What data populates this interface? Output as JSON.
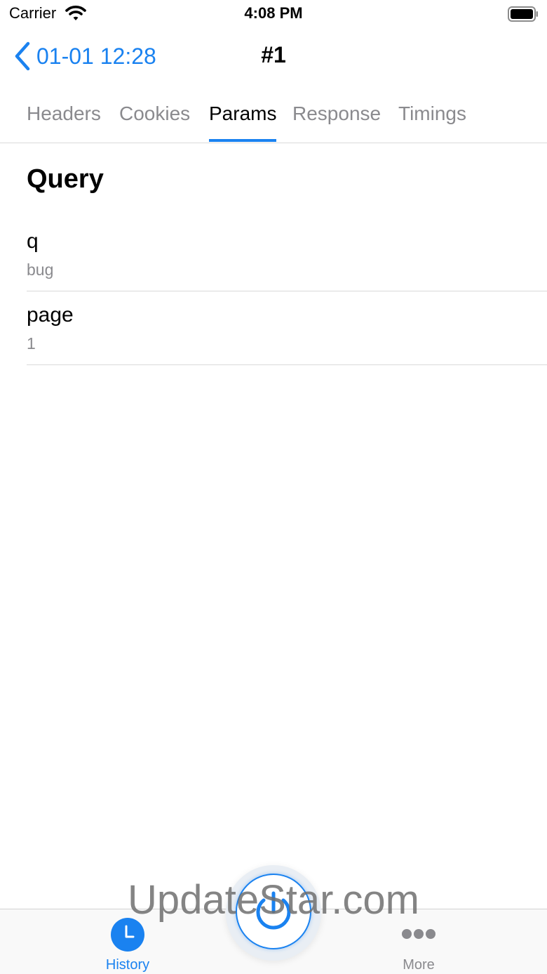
{
  "status_bar": {
    "carrier": "Carrier",
    "time": "4:08 PM"
  },
  "nav": {
    "back_label": "01-01 12:28",
    "title": "#1"
  },
  "tabs": [
    {
      "label": "Headers",
      "active": false
    },
    {
      "label": "Cookies",
      "active": false
    },
    {
      "label": "Params",
      "active": true
    },
    {
      "label": "Response",
      "active": false
    },
    {
      "label": "Timings",
      "active": false
    }
  ],
  "query": {
    "title": "Query",
    "params": [
      {
        "key": "q",
        "value": "bug"
      },
      {
        "key": "page",
        "value": "1"
      }
    ]
  },
  "tabbar": {
    "items": [
      {
        "label": "History",
        "icon": "clock-icon",
        "active": true
      },
      {
        "label": "More",
        "icon": "more-dots-icon",
        "active": false
      }
    ],
    "center_icon": "power-icon"
  },
  "watermark": "UpdateStar.com",
  "colors": {
    "accent": "#1a82f0",
    "secondary_text": "#8a8a8e",
    "separator": "#d9d9d9"
  }
}
